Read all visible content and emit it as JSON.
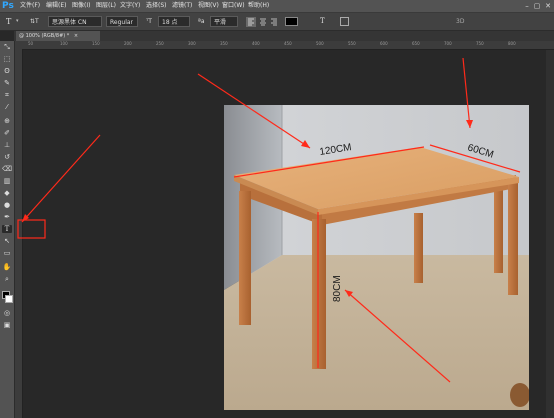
{
  "app": {
    "logo": "Ps"
  },
  "menu": {
    "items": [
      "文件(F)",
      "编辑(E)",
      "图像(I)",
      "图层(L)",
      "文字(Y)",
      "选择(S)",
      "滤镜(T)",
      "视图(V)",
      "窗口(W)",
      "帮助(H)"
    ]
  },
  "window_controls": {
    "minimize": "–",
    "maximize": "▢",
    "close": "✕"
  },
  "options": {
    "tool_glyph": "T",
    "orientation_glyph": "⇅T",
    "font_family": "思源黑体 CN",
    "font_style": "Regular",
    "size_glyph": "ᵀT",
    "font_size": "18 点",
    "aa_glyph": "ªa",
    "antialias": "平滑",
    "warp_glyph": "T",
    "mode_3d": "3D"
  },
  "tab": {
    "title": "@ 100% (RGB/8#) *",
    "close": "×"
  },
  "ruler_labels": [
    "50",
    "100",
    "150",
    "200",
    "250",
    "300",
    "350",
    "400",
    "450",
    "500",
    "550",
    "600",
    "650",
    "700",
    "750",
    "800"
  ],
  "tools": {
    "move": "⤡",
    "marquee": "⬚",
    "lasso": "ʘ",
    "quick_select": "✎",
    "crop": "⌗",
    "eyedropper": "⁄",
    "heal": "⊕",
    "brush": "✐",
    "stamp": "⊥",
    "history": "↺",
    "eraser": "⌫",
    "gradient": "▥",
    "blur": "◆",
    "dodge": "●",
    "pen": "✒",
    "type": "T",
    "path_select": "↖",
    "shape": "▭",
    "hand": "✋",
    "zoom": "⌕",
    "extra": "…",
    "quick_mask": "◎",
    "screen_mode": "▣"
  },
  "colors": {
    "foreground": "#000000",
    "background": "#ffffff",
    "arrow": "#ff2a1a",
    "highlight": "#ff2a1a"
  },
  "annotations": {
    "width": "120CM",
    "depth": "60CM",
    "height": "80CM"
  }
}
